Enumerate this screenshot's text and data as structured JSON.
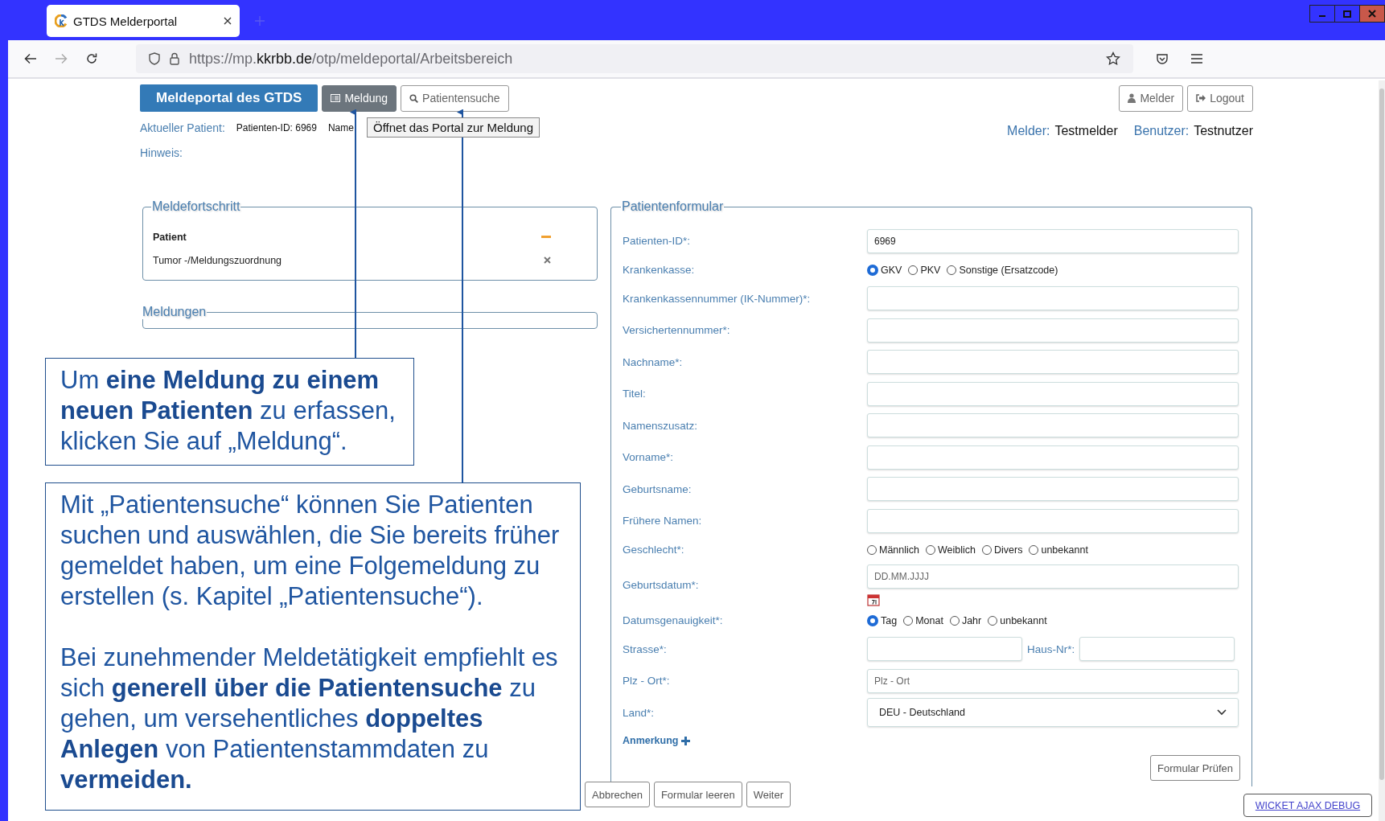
{
  "browser": {
    "tab": {
      "title": "GTDS Melderportal"
    },
    "url": {
      "prefix": "https://mp.",
      "host": "kkrbb.de",
      "path": "/otp/meldeportal/Arbeitsbereich"
    }
  },
  "header": {
    "brand": "Meldeportal des GTDS",
    "nav": [
      {
        "label": "Meldung",
        "selected": true
      },
      {
        "label": "Patientensuche",
        "selected": false
      }
    ],
    "user_buttons": [
      {
        "label": "Melder"
      },
      {
        "label": "Logout"
      }
    ],
    "tooltip": "Öffnet das Portal zur Meldung"
  },
  "patient_info": {
    "label": "Aktueller Patient:",
    "id": "Patienten-ID: 6969",
    "name_label": "Name",
    "hint_label": "Hinweis:"
  },
  "user_info": [
    {
      "label": "Melder:",
      "value": "Testmelder"
    },
    {
      "label": "Benutzer:",
      "value": "Testnutzer"
    }
  ],
  "progress": {
    "title": "Meldefortschritt",
    "steps": [
      {
        "label": "Patient",
        "selected": true,
        "kind": "current"
      },
      {
        "label": "Tumor -/Meldungszuordnung",
        "selected": false,
        "kind": "pending"
      }
    ]
  },
  "reports": {
    "title": "Meldungen"
  },
  "form": {
    "title": "Patientenformular",
    "fields": [
      {
        "kind": "text",
        "label": "Patienten-ID*:",
        "value": "6969"
      },
      {
        "kind": "radio",
        "label": "Krankenkasse:",
        "options": [
          {
            "label": "GKV",
            "selected": true
          },
          {
            "label": "PKV",
            "selected": false
          },
          {
            "label": "Sonstige (Ersatzcode)",
            "selected": false
          }
        ]
      },
      {
        "kind": "text",
        "label": "Krankenkassennummer (IK-Nummer)*:"
      },
      {
        "kind": "text",
        "label": "Versichertennummer*:"
      },
      {
        "kind": "text",
        "label": "Nachname*:"
      },
      {
        "kind": "text",
        "label": "Titel:"
      },
      {
        "kind": "text",
        "label": "Namenszusatz:"
      },
      {
        "kind": "text",
        "label": "Vorname*:"
      },
      {
        "kind": "text",
        "label": "Geburtsname:"
      },
      {
        "kind": "text",
        "label": "Frühere Namen:"
      },
      {
        "kind": "radio",
        "label": "Geschlecht*:",
        "options": [
          {
            "label": "Männlich",
            "selected": false
          },
          {
            "label": "Weiblich",
            "selected": false
          },
          {
            "label": "Divers",
            "selected": false
          },
          {
            "label": "unbekannt",
            "selected": false
          }
        ]
      },
      {
        "kind": "date",
        "label": "Geburtsdatum*:",
        "placeholder": "DD.MM.JJJJ"
      },
      {
        "kind": "radio",
        "label": "Datumsgenauigkeit*:",
        "options": [
          {
            "label": "Tag",
            "selected": true
          },
          {
            "label": "Monat",
            "selected": false
          },
          {
            "label": "Jahr",
            "selected": false
          },
          {
            "label": "unbekannt",
            "selected": false
          }
        ]
      },
      {
        "kind": "split",
        "label": "Strasse*:",
        "second_label": "Haus-Nr*:"
      },
      {
        "kind": "text",
        "label": "Plz - Ort*:",
        "placeholder": "Plz - Ort"
      },
      {
        "kind": "select",
        "label": "Land*:",
        "value": "DEU - Deutschland"
      }
    ],
    "note_link": "Anmerkung",
    "check_button": "Formular Prüfen"
  },
  "actions": [
    "Abbrechen",
    "Formular leeren",
    "Weiter"
  ],
  "debug_link": "WICKET AJAX DEBUG",
  "annotations": [
    {
      "paragraphs": [
        "Um **eine Meldung zu einem neuen Patienten** zu erfassen, klicken Sie auf „Meldung“."
      ]
    },
    {
      "paragraphs": [
        "Mit „Patientensuche“ können Sie Patienten suchen und auswählen, die Sie bereits früher gemeldet haben, um eine Folgemeldung zu erstellen (s. Kapitel „Patientensuche“).",
        "Bei zunehmender Meldetätigkeit empfiehlt es sich **generell über die Patientensuche** zu gehen, um versehentliches **doppeltes Anlegen** von Patientenstammdaten zu **vermeiden.**"
      ]
    }
  ]
}
